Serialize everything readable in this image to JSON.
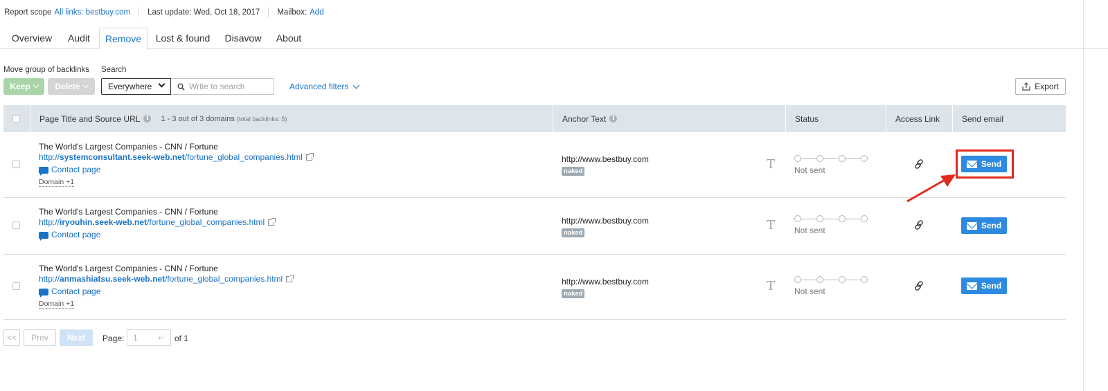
{
  "header": {
    "scope_label": "Report scope",
    "scope_value": "All links: bestbuy.com",
    "last_update": "Last update: Wed, Oct 18, 2017",
    "mailbox_label": "Mailbox:",
    "mailbox_add": "Add"
  },
  "tabs": [
    "Overview",
    "Audit",
    "Remove",
    "Lost & found",
    "Disavow",
    "About"
  ],
  "active_tab": "Remove",
  "toolbar": {
    "move_group_label": "Move group of backlinks",
    "search_label": "Search",
    "keep_label": "Keep",
    "delete_label": "Delete",
    "scope_select_value": "Everywhere",
    "search_placeholder": "Write to search",
    "advanced_filters": "Advanced filters",
    "export_label": "Export"
  },
  "table": {
    "columns": {
      "source": "Page Title and Source URL",
      "count": "1 - 3 out of 3 domains",
      "count_note": "(total backlinks: 5)",
      "anchor": "Anchor Text",
      "status": "Status",
      "access": "Access Link",
      "email": "Send email"
    },
    "rows": [
      {
        "title": "The World's Largest Companies - CNN / Fortune",
        "url_prefix": "http://",
        "url_domain": "systemconsultant.seek-web.net",
        "url_path": "/fortune_global_companies.html",
        "contact": "Contact page",
        "domain_more": "Domain +1",
        "anchor": "http://www.bestbuy.com",
        "anchor_tag": "naked",
        "status": "Not sent",
        "send": "Send"
      },
      {
        "title": "The World's Largest Companies - CNN / Fortune",
        "url_prefix": "http://",
        "url_domain": "iryouhin.seek-web.net",
        "url_path": "/fortune_global_companies.html",
        "contact": "Contact page",
        "domain_more": "",
        "anchor": "http://www.bestbuy.com",
        "anchor_tag": "naked",
        "status": "Not sent",
        "send": "Send"
      },
      {
        "title": "The World's Largest Companies - CNN / Fortune",
        "url_prefix": "http://",
        "url_domain": "anmashiatsu.seek-web.net",
        "url_path": "/fortune_global_companies.html",
        "contact": "Contact page",
        "domain_more": "Domain +1",
        "anchor": "http://www.bestbuy.com",
        "anchor_tag": "naked",
        "status": "Not sent",
        "send": "Send"
      }
    ]
  },
  "pagination": {
    "first": "<<",
    "prev": "Prev",
    "next": "Next",
    "page_label": "Page:",
    "page_value": "1",
    "of_label": "of 1"
  },
  "colors": {
    "accent": "#1a73c7",
    "send_button": "#2d8ae0",
    "highlight": "#e22a1d",
    "table_header": "#dde4ea"
  }
}
